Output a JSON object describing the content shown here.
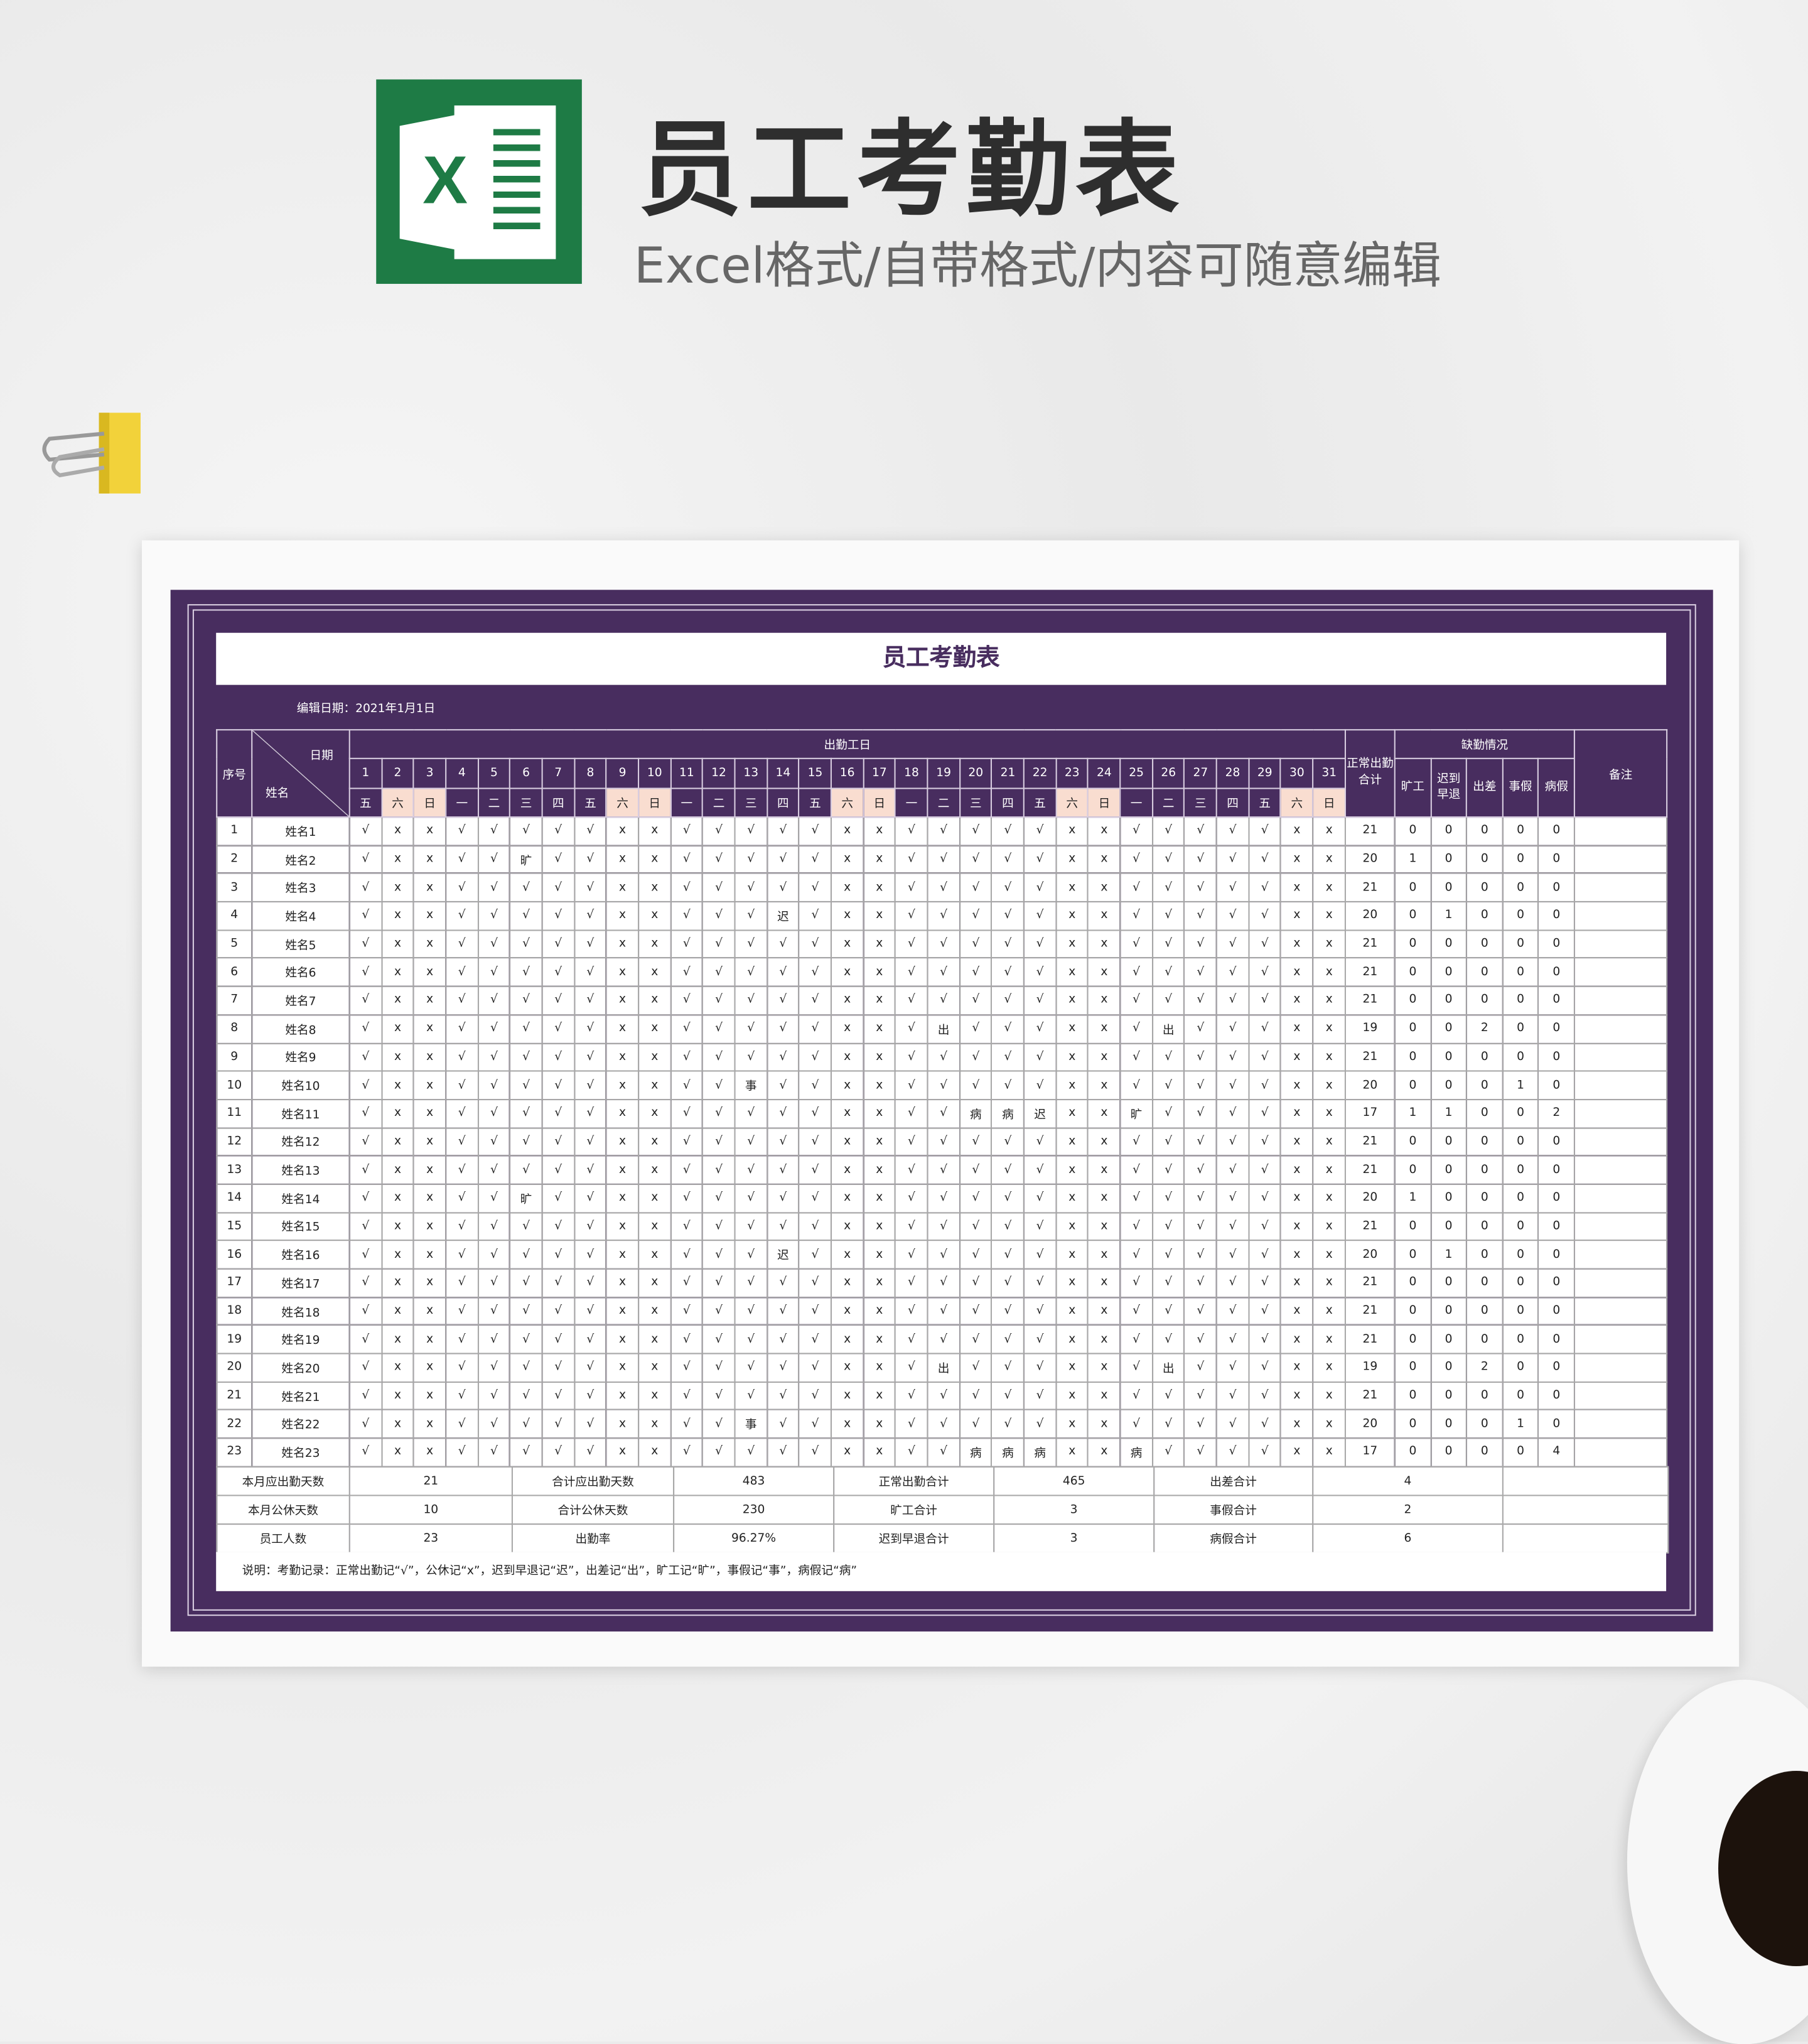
{
  "header": {
    "title": "员工考勤表",
    "subtitle": "Excel格式/自带格式/内容可随意编辑"
  },
  "logo": {
    "letter": "X",
    "color": "#1e7b45"
  },
  "colors": {
    "frame": "#482d5f",
    "weekend": "#f9ddd0"
  },
  "sheet": {
    "title": "员工考勤表",
    "edit_date": "编辑日期：2021年1月1日",
    "col_seq": "序号",
    "col_date": "日期",
    "col_name": "姓名",
    "group_days": "出勤工日",
    "col_normal": "正常出勤合计",
    "group_absence": "缺勤情况",
    "absence_cols": [
      "旷工",
      "迟到早退",
      "出差",
      "事假",
      "病假"
    ],
    "col_remark": "备注",
    "days": [
      "1",
      "2",
      "3",
      "4",
      "5",
      "6",
      "7",
      "8",
      "9",
      "10",
      "11",
      "12",
      "13",
      "14",
      "15",
      "16",
      "17",
      "18",
      "19",
      "20",
      "21",
      "22",
      "23",
      "24",
      "25",
      "26",
      "27",
      "28",
      "29",
      "30",
      "31"
    ],
    "weekdays": [
      "五",
      "六",
      "日",
      "一",
      "二",
      "三",
      "四",
      "五",
      "六",
      "日",
      "一",
      "二",
      "三",
      "四",
      "五",
      "六",
      "日",
      "一",
      "二",
      "三",
      "四",
      "五",
      "六",
      "日",
      "一",
      "二",
      "三",
      "四",
      "五",
      "六",
      "日"
    ],
    "rows": [
      {
        "no": "1",
        "name": "姓名1",
        "marks": "√xx√√√√√xx√√√√√xx√√√√√xx√√√√√xx",
        "totals": [
          "21",
          "0",
          "0",
          "0",
          "0",
          "0"
        ]
      },
      {
        "no": "2",
        "name": "姓名2",
        "marks": "√xx√√旷√√xx√√√√√xx√√√√√xx√√√√√xx",
        "totals": [
          "20",
          "1",
          "0",
          "0",
          "0",
          "0"
        ]
      },
      {
        "no": "3",
        "name": "姓名3",
        "marks": "√xx√√√√√xx√√√√√xx√√√√√xx√√√√√xx",
        "totals": [
          "21",
          "0",
          "0",
          "0",
          "0",
          "0"
        ]
      },
      {
        "no": "4",
        "name": "姓名4",
        "marks": "√xx√√√√√xx√√√迟√xx√√√√√xx√√√√√xx",
        "totals": [
          "20",
          "0",
          "1",
          "0",
          "0",
          "0"
        ]
      },
      {
        "no": "5",
        "name": "姓名5",
        "marks": "√xx√√√√√xx√√√√√xx√√√√√xx√√√√√xx",
        "totals": [
          "21",
          "0",
          "0",
          "0",
          "0",
          "0"
        ]
      },
      {
        "no": "6",
        "name": "姓名6",
        "marks": "√xx√√√√√xx√√√√√xx√√√√√xx√√√√√xx",
        "totals": [
          "21",
          "0",
          "0",
          "0",
          "0",
          "0"
        ]
      },
      {
        "no": "7",
        "name": "姓名7",
        "marks": "√xx√√√√√xx√√√√√xx√√√√√xx√√√√√xx",
        "totals": [
          "21",
          "0",
          "0",
          "0",
          "0",
          "0"
        ]
      },
      {
        "no": "8",
        "name": "姓名8",
        "marks": "√xx√√√√√xx√√√√√xx√出√√√xx√出√√√xx",
        "totals": [
          "19",
          "0",
          "0",
          "2",
          "0",
          "0"
        ]
      },
      {
        "no": "9",
        "name": "姓名9",
        "marks": "√xx√√√√√xx√√√√√xx√√√√√xx√√√√√xx",
        "totals": [
          "21",
          "0",
          "0",
          "0",
          "0",
          "0"
        ]
      },
      {
        "no": "10",
        "name": "姓名10",
        "marks": "√xx√√√√√xx√√事√√xx√√√√√xx√√√√√xx",
        "totals": [
          "20",
          "0",
          "0",
          "0",
          "1",
          "0"
        ]
      },
      {
        "no": "11",
        "name": "姓名11",
        "marks": "√xx√√√√√xx√√√√√xx√√病病迟xx旷√√√√xx",
        "totals": [
          "17",
          "1",
          "1",
          "0",
          "0",
          "2"
        ]
      },
      {
        "no": "12",
        "name": "姓名12",
        "marks": "√xx√√√√√xx√√√√√xx√√√√√xx√√√√√xx",
        "totals": [
          "21",
          "0",
          "0",
          "0",
          "0",
          "0"
        ]
      },
      {
        "no": "13",
        "name": "姓名13",
        "marks": "√xx√√√√√xx√√√√√xx√√√√√xx√√√√√xx",
        "totals": [
          "21",
          "0",
          "0",
          "0",
          "0",
          "0"
        ]
      },
      {
        "no": "14",
        "name": "姓名14",
        "marks": "√xx√√旷√√xx√√√√√xx√√√√√xx√√√√√xx",
        "totals": [
          "20",
          "1",
          "0",
          "0",
          "0",
          "0"
        ]
      },
      {
        "no": "15",
        "name": "姓名15",
        "marks": "√xx√√√√√xx√√√√√xx√√√√√xx√√√√√xx",
        "totals": [
          "21",
          "0",
          "0",
          "0",
          "0",
          "0"
        ]
      },
      {
        "no": "16",
        "name": "姓名16",
        "marks": "√xx√√√√√xx√√√迟√xx√√√√√xx√√√√√xx",
        "totals": [
          "20",
          "0",
          "1",
          "0",
          "0",
          "0"
        ]
      },
      {
        "no": "17",
        "name": "姓名17",
        "marks": "√xx√√√√√xx√√√√√xx√√√√√xx√√√√√xx",
        "totals": [
          "21",
          "0",
          "0",
          "0",
          "0",
          "0"
        ]
      },
      {
        "no": "18",
        "name": "姓名18",
        "marks": "√xx√√√√√xx√√√√√xx√√√√√xx√√√√√xx",
        "totals": [
          "21",
          "0",
          "0",
          "0",
          "0",
          "0"
        ]
      },
      {
        "no": "19",
        "name": "姓名19",
        "marks": "√xx√√√√√xx√√√√√xx√√√√√xx√√√√√xx",
        "totals": [
          "21",
          "0",
          "0",
          "0",
          "0",
          "0"
        ]
      },
      {
        "no": "20",
        "name": "姓名20",
        "marks": "√xx√√√√√xx√√√√√xx√出√√√xx√出√√√xx",
        "totals": [
          "19",
          "0",
          "0",
          "2",
          "0",
          "0"
        ]
      },
      {
        "no": "21",
        "name": "姓名21",
        "marks": "√xx√√√√√xx√√√√√xx√√√√√xx√√√√√xx",
        "totals": [
          "21",
          "0",
          "0",
          "0",
          "0",
          "0"
        ]
      },
      {
        "no": "22",
        "name": "姓名22",
        "marks": "√xx√√√√√xx√√事√√xx√√√√√xx√√√√√xx",
        "totals": [
          "20",
          "0",
          "0",
          "0",
          "1",
          "0"
        ]
      },
      {
        "no": "23",
        "name": "姓名23",
        "marks": "√xx√√√√√xx√√√√√xx√√病病病xx病√√√√xx",
        "totals": [
          "17",
          "0",
          "0",
          "0",
          "0",
          "4"
        ]
      }
    ],
    "summary": [
      [
        "本月应出勤天数",
        "21",
        "合计应出勤天数",
        "483",
        "正常出勤合计",
        "465",
        "出差合计",
        "4"
      ],
      [
        "本月公休天数",
        "10",
        "合计公休天数",
        "230",
        "旷工合计",
        "3",
        "事假合计",
        "2"
      ],
      [
        "员工人数",
        "23",
        "出勤率",
        "96.27%",
        "迟到早退合计",
        "3",
        "病假合计",
        "6"
      ]
    ],
    "note": "说明：考勤记录：正常出勤记“√”，公休记“x”，迟到早退记“迟”，出差记“出”，旷工记“旷”，事假记“事”，病假记“病”"
  }
}
